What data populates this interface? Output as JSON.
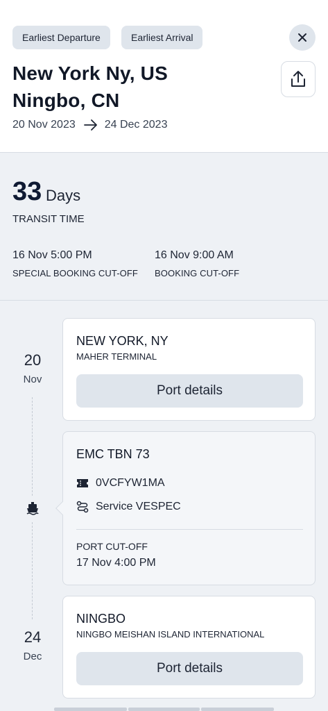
{
  "header": {
    "filters": [
      "Earliest Departure",
      "Earliest Arrival"
    ],
    "origin": "New York Ny, US",
    "destination": "Ningbo, CN",
    "departure_date": "20 Nov 2023",
    "arrival_date": "24 Dec 2023"
  },
  "transit": {
    "days": "33",
    "days_unit": "Days",
    "label": "TRANSIT TIME",
    "special_cutoff_value": "16 Nov 5:00 PM",
    "special_cutoff_label": "SPECIAL BOOKING CUT-OFF",
    "booking_cutoff_value": "16 Nov 9:00 AM",
    "booking_cutoff_label": "BOOKING CUT-OFF"
  },
  "timeline": {
    "start_day": "20",
    "start_month": "Nov",
    "end_day": "24",
    "end_month": "Dec"
  },
  "origin_card": {
    "port": "NEW YORK, NY",
    "terminal": "MAHER TERMINAL",
    "button": "Port details"
  },
  "vessel_card": {
    "name": "EMC TBN 73",
    "voyage": "0VCFYW1MA",
    "service": "Service VESPEC",
    "cutoff_label": "PORT CUT-OFF",
    "cutoff_value": "17 Nov 4:00 PM"
  },
  "destination_card": {
    "port": "NINGBO",
    "terminal": "NINGBO MEISHAN ISLAND INTERNATIONAL",
    "button": "Port details"
  },
  "icons": {
    "close": "close-icon",
    "share": "share-icon",
    "arrow": "arrow-right-icon",
    "ship": "ship-icon",
    "ticket": "ticket-icon",
    "route": "route-icon"
  },
  "colors": {
    "background": "#eef1f5",
    "chip": "#dfe5ec",
    "card": "#ffffff",
    "text": "#1d2433"
  }
}
